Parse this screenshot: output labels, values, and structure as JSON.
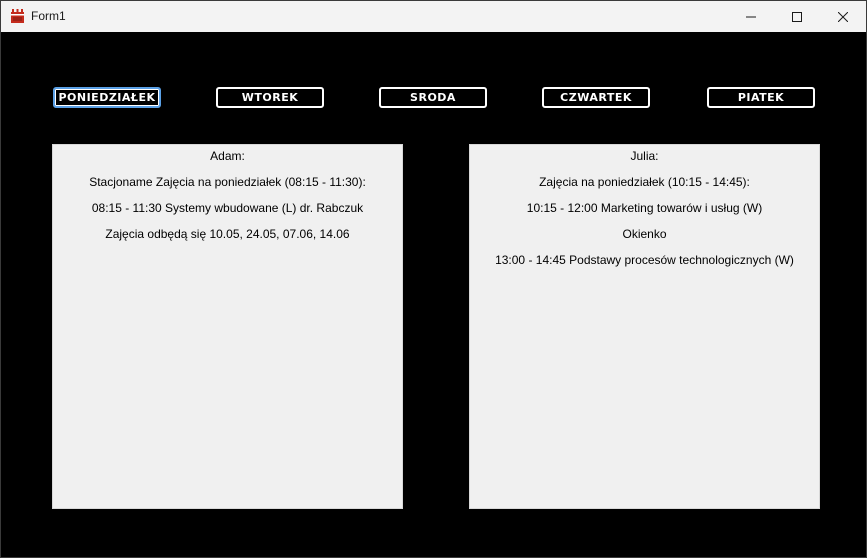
{
  "window": {
    "title": "Form1"
  },
  "days": [
    {
      "label": "PONIEDZIAŁEK",
      "active": true
    },
    {
      "label": "WTOREK",
      "active": false
    },
    {
      "label": "SRODA",
      "active": false
    },
    {
      "label": "CZWARTEK",
      "active": false
    },
    {
      "label": "PIATEK",
      "active": false
    }
  ],
  "panels": {
    "left": {
      "lines": [
        "Adam:",
        "Stacjoname Zajęcia na poniedziałek (08:15 - 11:30):",
        "08:15 - 11:30 Systemy wbudowane (L) dr. Rabczuk",
        "Zajęcia odbędą się 10.05, 24.05, 07.06, 14.06"
      ]
    },
    "right": {
      "lines": [
        "Julia:",
        "Zajęcia na poniedziałek (10:15 - 14:45):",
        "10:15 - 12:00 Marketing towarów i usług (W)",
        "Okienko",
        "13:00 - 14:45 Podstawy procesów technologicznych (W)"
      ]
    }
  },
  "icons": {
    "app": "app-icon",
    "minimize": "minimize-icon",
    "maximize": "maximize-icon",
    "close": "close-icon"
  },
  "colors": {
    "background": "#000000",
    "titlebar": "#f3f3f3",
    "panel": "#f0f0f0",
    "button_border": "#ffffff",
    "active_accent": "#5aa0e6"
  }
}
